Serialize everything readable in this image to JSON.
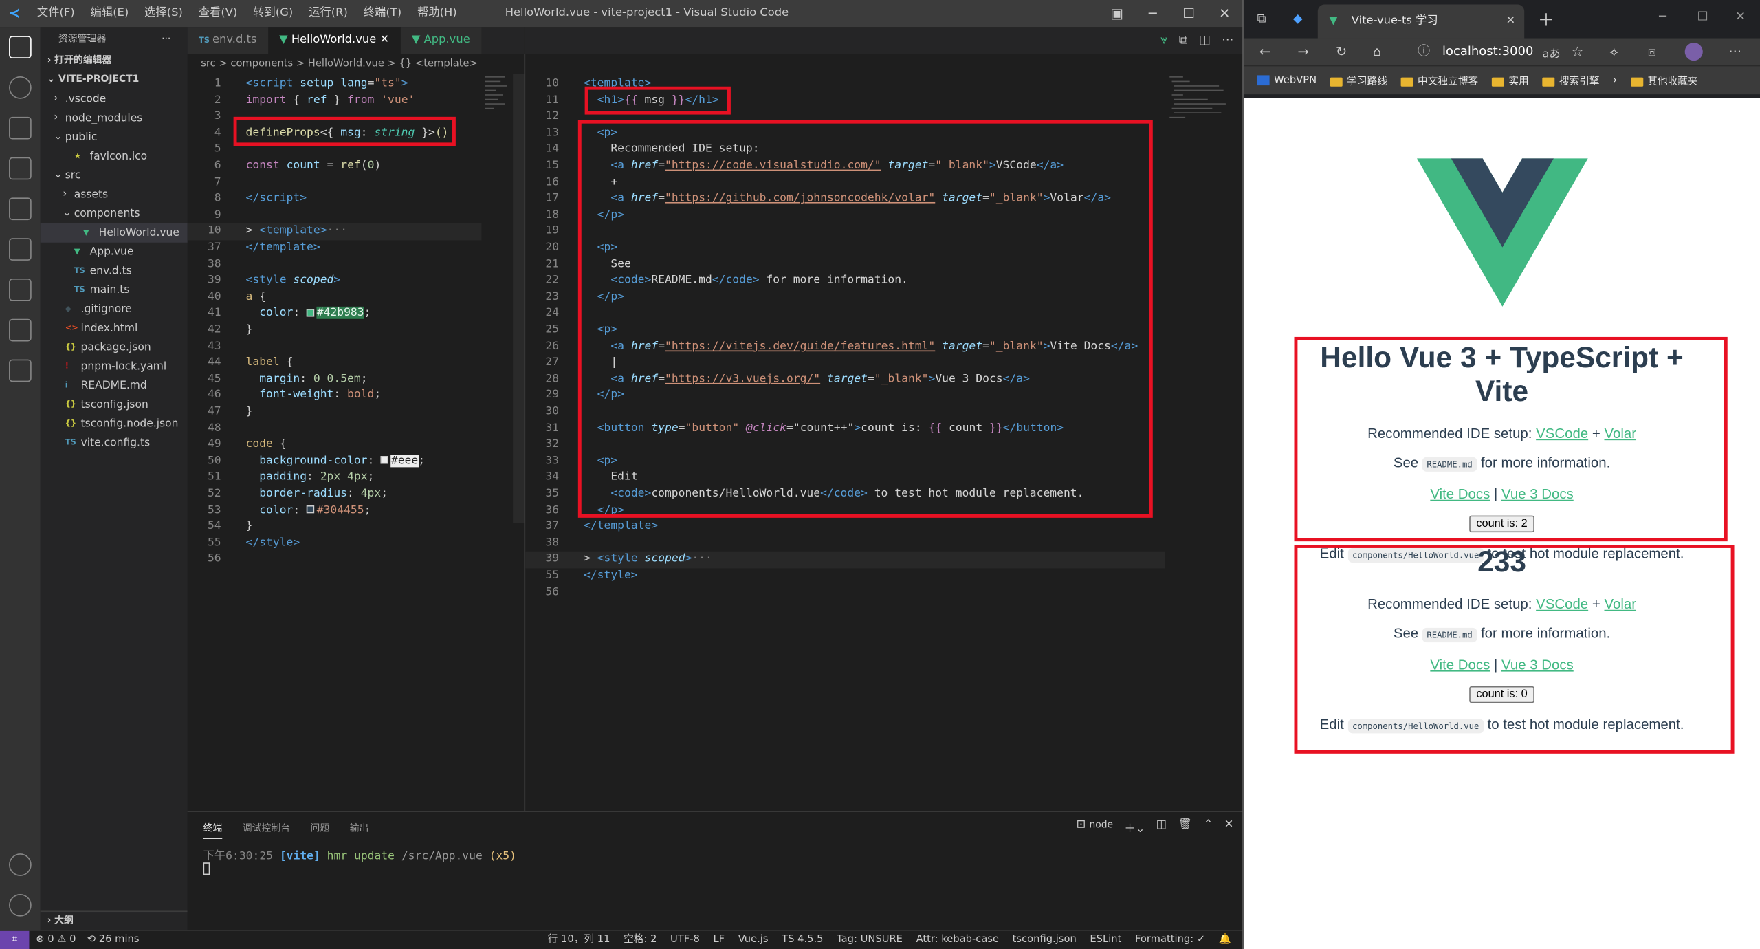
{
  "vscode": {
    "title": "HelloWorld.vue - vite-project1 - Visual Studio Code",
    "menu": [
      "文件(F)",
      "编辑(E)",
      "选择(S)",
      "查看(V)",
      "转到(G)",
      "运行(R)",
      "终端(T)",
      "帮助(H)"
    ],
    "explorer_title": "资源管理器",
    "open_editors": "打开的编辑器",
    "project": "VITE-PROJECT1",
    "tree": [
      {
        "label": ".vscode",
        "kind": "folder",
        "open": false,
        "depth": 1
      },
      {
        "label": "node_modules",
        "kind": "folder",
        "open": false,
        "depth": 1
      },
      {
        "label": "public",
        "kind": "folder",
        "open": true,
        "depth": 1
      },
      {
        "label": "favicon.ico",
        "kind": "star",
        "depth": 2
      },
      {
        "label": "src",
        "kind": "folder",
        "open": true,
        "depth": 1
      },
      {
        "label": "assets",
        "kind": "folder",
        "open": false,
        "depth": 2
      },
      {
        "label": "components",
        "kind": "folder",
        "open": true,
        "depth": 2
      },
      {
        "label": "HelloWorld.vue",
        "kind": "vue",
        "depth": 3,
        "selected": true
      },
      {
        "label": "App.vue",
        "kind": "vue",
        "depth": 2
      },
      {
        "label": "env.d.ts",
        "kind": "ts",
        "depth": 2
      },
      {
        "label": "main.ts",
        "kind": "ts",
        "depth": 2
      },
      {
        "label": ".gitignore",
        "kind": "git",
        "depth": 1
      },
      {
        "label": "index.html",
        "kind": "html",
        "depth": 1
      },
      {
        "label": "package.json",
        "kind": "json",
        "depth": 1
      },
      {
        "label": "pnpm-lock.yaml",
        "kind": "yaml",
        "depth": 1
      },
      {
        "label": "README.md",
        "kind": "md",
        "depth": 1
      },
      {
        "label": "tsconfig.json",
        "kind": "json",
        "depth": 1
      },
      {
        "label": "tsconfig.node.json",
        "kind": "json",
        "depth": 1
      },
      {
        "label": "vite.config.ts",
        "kind": "ts",
        "depth": 1
      }
    ],
    "outline": "大纲",
    "tabs": [
      "env.d.ts",
      "HelloWorld.vue",
      "App.vue"
    ],
    "breadcrumb": "src > components > HelloWorld.vue > {} <template>",
    "left_lines": [
      {
        "n": "1",
        "h": "<span class='t-tag'>&lt;script</span> <span class='t-attr'>setup</span> <span class='t-attr'>lang</span>=<span class='t-str'>\"ts\"</span><span class='t-tag'>&gt;</span>"
      },
      {
        "n": "2",
        "h": "<span class='t-kw'>import</span> <span class='t-txt'>{ </span><span class='t-attr'>ref</span><span class='t-txt'> } </span><span class='t-kw'>from</span> <span class='t-str'>'vue'</span>"
      },
      {
        "n": "3",
        "h": ""
      },
      {
        "n": "4",
        "h": "<span class='t-fn'>defineProps</span><span class='t-txt'>&lt;{ </span><span class='t-attr'>msg</span><span class='t-txt'>: </span><span class='t-type' style='font-style:italic'>string</span><span class='t-txt'> }&gt;</span><span class='t-fn'>()</span>"
      },
      {
        "n": "5",
        "h": ""
      },
      {
        "n": "6",
        "h": "<span class='t-kw'>const</span> <span class='t-attr'>count</span> <span class='t-txt'>=</span> <span class='t-fn'>ref</span><span class='t-txt'>(</span><span class='t-num'>0</span><span class='t-txt'>)</span>"
      },
      {
        "n": "7",
        "h": ""
      },
      {
        "n": "8",
        "h": "<span class='t-tag'>&lt;/script&gt;</span>"
      },
      {
        "n": "9",
        "h": ""
      },
      {
        "n": "10",
        "h": "<span class='t-txt'>&gt; </span><span class='t-tag'>&lt;template&gt;</span><span class='t-punc'>···</span>",
        "hl": true
      },
      {
        "n": "37",
        "h": "<span class='t-tag'>&lt;/template&gt;</span>"
      },
      {
        "n": "38",
        "h": ""
      },
      {
        "n": "39",
        "h": "<span class='t-tag'>&lt;style</span> <span class='t-attr' style='font-style:italic'>scoped</span><span class='t-tag'>&gt;</span>"
      },
      {
        "n": "40",
        "h": "<span class='t-sel'>a</span> <span class='t-txt'>{</span>"
      },
      {
        "n": "41",
        "h": "  <span class='t-prop'>color</span><span class='t-txt'>: </span><span class='swatch' style='background:#42b983'></span><span class='t-str' style='background:#2e7d4f;color:#e6f5ec'>#42b983</span><span class='t-txt'>;</span>"
      },
      {
        "n": "42",
        "h": "<span class='t-txt'>}</span>"
      },
      {
        "n": "43",
        "h": ""
      },
      {
        "n": "44",
        "h": "<span class='t-sel'>label</span> <span class='t-txt'>{</span>"
      },
      {
        "n": "45",
        "h": "  <span class='t-prop'>margin</span><span class='t-txt'>: </span><span class='t-num'>0 0.5em</span><span class='t-txt'>;</span>"
      },
      {
        "n": "46",
        "h": "  <span class='t-prop'>font-weight</span><span class='t-txt'>: </span><span class='t-str'>bold</span><span class='t-txt'>;</span>"
      },
      {
        "n": "47",
        "h": "<span class='t-txt'>}</span>"
      },
      {
        "n": "48",
        "h": ""
      },
      {
        "n": "49",
        "h": "<span class='t-sel'>code</span> <span class='t-txt'>{</span>"
      },
      {
        "n": "50",
        "h": "  <span class='t-prop'>background-color</span><span class='t-txt'>: </span><span class='swatch' style='background:#eee'></span><span style='background:#eee;color:#222'>#eee</span><span class='t-txt'>;</span>"
      },
      {
        "n": "51",
        "h": "  <span class='t-prop'>padding</span><span class='t-txt'>: </span><span class='t-num'>2px 4px</span><span class='t-txt'>;</span>"
      },
      {
        "n": "52",
        "h": "  <span class='t-prop'>border-radius</span><span class='t-txt'>: </span><span class='t-num'>4px</span><span class='t-txt'>;</span>"
      },
      {
        "n": "53",
        "h": "  <span class='t-prop'>color</span><span class='t-txt'>: </span><span class='swatch' style='background:#304455'></span><span class='t-str'>#304455</span><span class='t-txt'>;</span>"
      },
      {
        "n": "54",
        "h": "<span class='t-txt'>}</span>"
      },
      {
        "n": "55",
        "h": "<span class='t-tag'>&lt;/style&gt;</span>"
      },
      {
        "n": "56",
        "h": ""
      }
    ],
    "right_lines": [
      {
        "n": "10",
        "h": "<span class='t-tag'>&lt;template&gt;</span>"
      },
      {
        "n": "11",
        "h": "  <span class='t-tag'>&lt;h1&gt;</span><span class='t-kw'>{{</span><span class='t-txt'> msg </span><span class='t-kw'>}}</span><span class='t-tag'>&lt;/h1&gt;</span>"
      },
      {
        "n": "12",
        "h": ""
      },
      {
        "n": "13",
        "h": "  <span class='t-tag'>&lt;p&gt;</span>"
      },
      {
        "n": "14",
        "h": "    <span class='t-txt'>Recommended IDE setup:</span>"
      },
      {
        "n": "15",
        "h": "    <span class='t-tag'>&lt;a</span> <span class='t-attr' style='font-style:italic'>href</span>=<span class='t-link'>\"https://code.visualstudio.com/\"</span> <span class='t-attr' style='font-style:italic'>target</span>=<span class='t-str'>\"_blank\"</span><span class='t-tag'>&gt;</span><span class='t-txt'>VSCode</span><span class='t-tag'>&lt;/a&gt;</span>"
      },
      {
        "n": "16",
        "h": "    <span class='t-txt'>+</span>"
      },
      {
        "n": "17",
        "h": "    <span class='t-tag'>&lt;a</span> <span class='t-attr' style='font-style:italic'>href</span>=<span class='t-link'>\"https://github.com/johnsoncodehk/volar\"</span> <span class='t-attr' style='font-style:italic'>target</span>=<span class='t-str'>\"_blank\"</span><span class='t-tag'>&gt;</span><span class='t-txt'>Volar</span><span class='t-tag'>&lt;/a&gt;</span>"
      },
      {
        "n": "18",
        "h": "  <span class='t-tag'>&lt;/p&gt;</span>"
      },
      {
        "n": "19",
        "h": ""
      },
      {
        "n": "20",
        "h": "  <span class='t-tag'>&lt;p&gt;</span>"
      },
      {
        "n": "21",
        "h": "    <span class='t-txt'>See</span>"
      },
      {
        "n": "22",
        "h": "    <span class='t-tag'>&lt;code&gt;</span><span class='t-txt'>README.md</span><span class='t-tag'>&lt;/code&gt;</span><span class='t-txt'> for more information.</span>"
      },
      {
        "n": "23",
        "h": "  <span class='t-tag'>&lt;/p&gt;</span>"
      },
      {
        "n": "24",
        "h": ""
      },
      {
        "n": "25",
        "h": "  <span class='t-tag'>&lt;p&gt;</span>"
      },
      {
        "n": "26",
        "h": "    <span class='t-tag'>&lt;a</span> <span class='t-attr' style='font-style:italic'>href</span>=<span class='t-link'>\"https://vitejs.dev/guide/features.html\"</span> <span class='t-attr' style='font-style:italic'>target</span>=<span class='t-str'>\"_blank\"</span><span class='t-tag'>&gt;</span><span class='t-txt'>Vite Docs</span><span class='t-tag'>&lt;/a&gt;</span>"
      },
      {
        "n": "27",
        "h": "    <span class='t-txt'>|</span>"
      },
      {
        "n": "28",
        "h": "    <span class='t-tag'>&lt;a</span> <span class='t-attr' style='font-style:italic'>href</span>=<span class='t-link'>\"https://v3.vuejs.org/\"</span> <span class='t-attr' style='font-style:italic'>target</span>=<span class='t-str'>\"_blank\"</span><span class='t-tag'>&gt;</span><span class='t-txt'>Vue 3 Docs</span><span class='t-tag'>&lt;/a&gt;</span>"
      },
      {
        "n": "29",
        "h": "  <span class='t-tag'>&lt;/p&gt;</span>"
      },
      {
        "n": "30",
        "h": ""
      },
      {
        "n": "31",
        "h": "  <span class='t-tag'>&lt;button</span> <span class='t-attr' style='font-style:italic'>type</span>=<span class='t-str'>\"button\"</span> <span class='t-kw' style='font-style:italic'>@click</span>=<span class='t-txt'>\"count++\"</span><span class='t-tag'>&gt;</span><span class='t-txt'>count is: </span><span class='t-kw'>{{</span><span class='t-txt'> count </span><span class='t-kw'>}}</span><span class='t-tag'>&lt;/button&gt;</span>"
      },
      {
        "n": "32",
        "h": ""
      },
      {
        "n": "33",
        "h": "  <span class='t-tag'>&lt;p&gt;</span>"
      },
      {
        "n": "34",
        "h": "    <span class='t-txt'>Edit</span>"
      },
      {
        "n": "35",
        "h": "    <span class='t-tag'>&lt;code&gt;</span><span class='t-txt'>components/HelloWorld.vue</span><span class='t-tag'>&lt;/code&gt;</span><span class='t-txt'> to test hot module replacement.</span>"
      },
      {
        "n": "36",
        "h": "  <span class='t-tag'>&lt;/p&gt;</span>"
      },
      {
        "n": "37",
        "h": "<span class='t-tag'>&lt;/template&gt;</span>"
      },
      {
        "n": "38",
        "h": ""
      },
      {
        "n": "39",
        "h": "<span class='t-txt'>&gt; </span><span class='t-tag'>&lt;style</span> <span class='t-attr' style='font-style:italic'>scoped</span><span class='t-tag'>&gt;</span><span class='t-punc'>···</span>",
        "hl": true
      },
      {
        "n": "55",
        "h": "<span class='t-tag'>&lt;/style&gt;</span>"
      },
      {
        "n": "56",
        "h": ""
      }
    ],
    "panel_tabs": [
      "终端",
      "调试控制台",
      "问题",
      "输出"
    ],
    "terminal_shell": "node",
    "terminal_time": "下午6:30:25",
    "terminal_vite": "[vite]",
    "terminal_hmr": "hmr update",
    "terminal_path": "/src/App.vue",
    "terminal_count": "(x5)",
    "status_left": [
      "⊗ 0 ⚠ 0",
      "⟲ 26 mins"
    ],
    "status_right": [
      "行 10，列 11",
      "空格: 2",
      "UTF-8",
      "LF",
      "Vue.js",
      "TS 4.5.5",
      "Tag: UNSURE",
      "Attr: kebab-case",
      "tsconfig.json",
      "ESLint",
      "Formatting: ✓"
    ]
  },
  "browser": {
    "tab_title": "Vite-vue-ts 学习",
    "url": "localhost:3000",
    "bookmarks": [
      "WebVPN",
      "学习路线",
      "中文独立博客",
      "实用",
      "搜索引擎",
      "其他收藏夹"
    ],
    "component1": {
      "heading": "Hello Vue 3 + TypeScript + Vite",
      "ide_text": "Recommended IDE setup:",
      "vscode_link": "VSCode",
      "plus": "+",
      "volar_link": "Volar",
      "see": "See",
      "readme": "README.md",
      "more": "for more information.",
      "vite_docs": "Vite Docs",
      "pipe": "|",
      "vue_docs": "Vue 3 Docs",
      "button": "count is: 2",
      "edit": "Edit",
      "edit_code": "components/HelloWorld.vue",
      "edit_rest": "to test hot module replacement."
    },
    "component2": {
      "heading": "233",
      "ide_text": "Recommended IDE setup:",
      "vscode_link": "VSCode",
      "plus": "+",
      "volar_link": "Volar",
      "see": "See",
      "readme": "README.md",
      "more": "for more information.",
      "vite_docs": "Vite Docs",
      "pipe": "|",
      "vue_docs": "Vue 3 Docs",
      "button": "count is: 0",
      "edit": "Edit",
      "edit_code": "components/HelloWorld.vue",
      "edit_rest": "to test hot module replacement."
    },
    "colors": {
      "vue_green": "#42b983",
      "vue_dark": "#35495e",
      "highlight_red": "#e81123"
    }
  }
}
